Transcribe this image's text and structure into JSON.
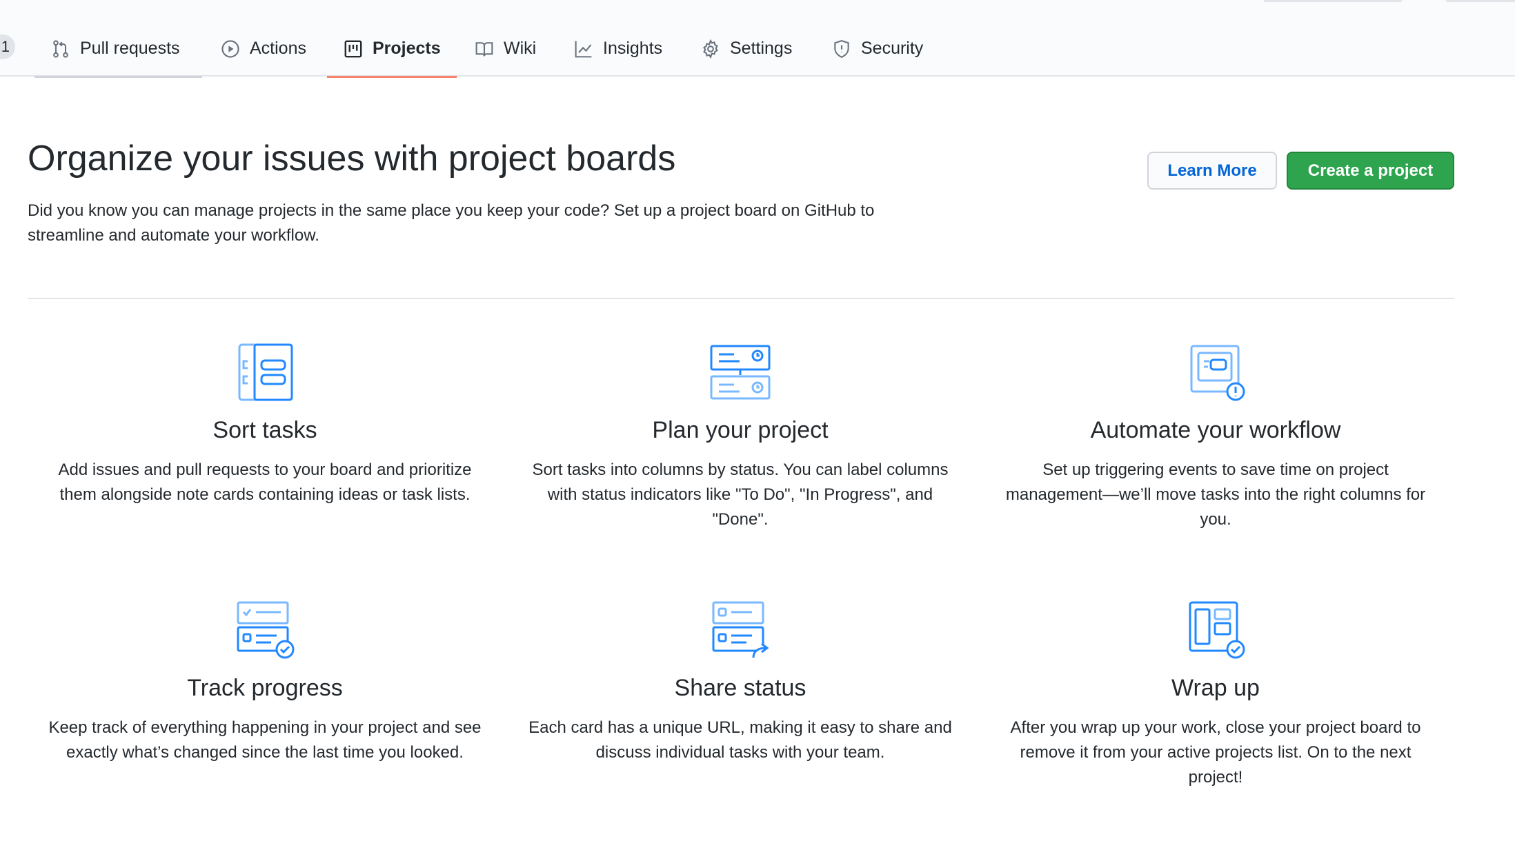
{
  "tabs": {
    "counter": "1",
    "items": [
      {
        "label": "Pull requests",
        "icon": "git-pull-request-icon"
      },
      {
        "label": "Actions",
        "icon": "play-icon"
      },
      {
        "label": "Projects",
        "icon": "project-icon",
        "selected": true
      },
      {
        "label": "Wiki",
        "icon": "book-icon"
      },
      {
        "label": "Insights",
        "icon": "graph-icon"
      },
      {
        "label": "Settings",
        "icon": "gear-icon"
      },
      {
        "label": "Security",
        "icon": "shield-icon"
      }
    ]
  },
  "header": {
    "title": "Organize your issues with project boards",
    "description": "Did you know you can manage projects in the same place you keep your code? Set up a project board on GitHub to streamline and automate your workflow.",
    "learn_more_label": "Learn More",
    "create_label": "Create a project"
  },
  "features": [
    {
      "title": "Sort tasks",
      "text": "Add issues and pull requests to your board and prioritize them alongside note cards containing ideas or task lists.",
      "icon": "sort-tasks-icon"
    },
    {
      "title": "Plan your project",
      "text": "Sort tasks into columns by status. You can label columns with status indicators like \"To Do\", \"In Progress\", and \"Done\".",
      "icon": "plan-project-icon"
    },
    {
      "title": "Automate your workflow",
      "text": "Set up triggering events to save time on project management—we’ll move tasks into the right columns for you.",
      "icon": "automate-workflow-icon"
    },
    {
      "title": "Track progress",
      "text": "Keep track of everything happening in your project and see exactly what’s changed since the last time you looked.",
      "icon": "track-progress-icon"
    },
    {
      "title": "Share status",
      "text": "Each card has a unique URL, making it easy to share and discuss individual tasks with your team.",
      "icon": "share-status-icon"
    },
    {
      "title": "Wrap up",
      "text": "After you wrap up your work, close your project board to remove it from your active projects list. On to the next project!",
      "icon": "wrap-up-icon"
    }
  ],
  "colors": {
    "accent_underline": "#f9826c",
    "primary_button": "#2ea44f",
    "link_blue": "#0366d6",
    "illustration_blue": "#2188ff"
  }
}
